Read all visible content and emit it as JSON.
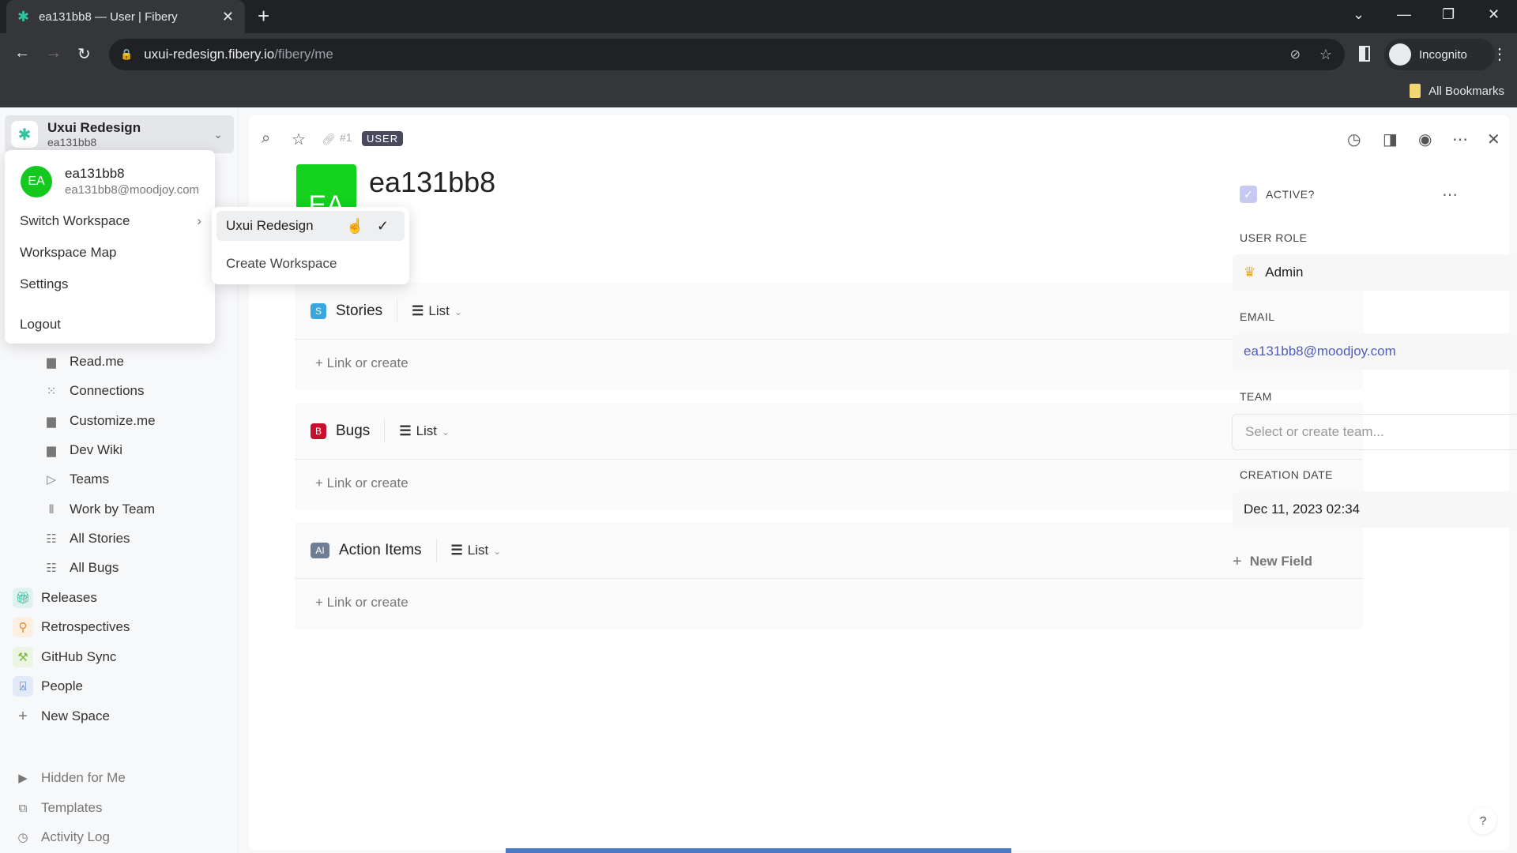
{
  "browser": {
    "tab_title": "ea131bb8 — User | Fibery",
    "url_host": "uxui-redesign.fibery.io",
    "url_path": "/fibery/me",
    "profile_label": "Incognito",
    "bookmarks_label": "All Bookmarks"
  },
  "workspace": {
    "name": "Uxui Redesign",
    "user": "ea131bb8"
  },
  "account_menu": {
    "avatar_initials": "EA",
    "user_name": "ea131bb8",
    "user_email": "ea131bb8@moodjoy.com",
    "items": [
      "Switch Workspace",
      "Workspace Map",
      "Settings",
      "Logout"
    ]
  },
  "switch_submenu": {
    "selected": "Uxui Redesign",
    "create": "Create Workspace"
  },
  "sidebar": {
    "items": [
      {
        "label": "Read.me",
        "icon": "document-icon"
      },
      {
        "label": "Connections",
        "icon": "connections-icon"
      },
      {
        "label": "Customize.me",
        "icon": "document-icon"
      },
      {
        "label": "Dev Wiki",
        "icon": "document-icon"
      },
      {
        "label": "Teams",
        "icon": "triangle-icon"
      },
      {
        "label": "Work by Team",
        "icon": "board-icon"
      },
      {
        "label": "All Stories",
        "icon": "grid-icon"
      },
      {
        "label": "All Bugs",
        "icon": "grid-icon"
      }
    ],
    "spaces": [
      {
        "label": "Releases",
        "icon": "gift-icon",
        "color": "#2bb596"
      },
      {
        "label": "Retrospectives",
        "icon": "retro-icon",
        "color": "#e58a2c"
      },
      {
        "label": "GitHub Sync",
        "icon": "screw-icon",
        "color": "#7dba45"
      },
      {
        "label": "People",
        "icon": "person-icon",
        "color": "#2e62c9"
      },
      {
        "label": "New Space",
        "icon": "plus-icon"
      }
    ],
    "footer": [
      {
        "label": "Hidden for Me",
        "icon": "caret-right-icon"
      },
      {
        "label": "Templates",
        "icon": "templates-icon"
      },
      {
        "label": "Activity Log",
        "icon": "clock-icon"
      }
    ]
  },
  "entity": {
    "id_ref": "#1",
    "type_badge": "USER",
    "avatar_initials": "EA",
    "avatar_color": "#14d21e",
    "title": "ea131bb8"
  },
  "sections": [
    {
      "tag": "S",
      "tag_color": "#3aa7dc",
      "name": "Stories",
      "view": "List",
      "link": "Link or create"
    },
    {
      "tag": "B",
      "tag_color": "#c8102e",
      "name": "Bugs",
      "view": "List",
      "link": "Link or create"
    },
    {
      "tag": "AI",
      "tag_color": "#6f7d94",
      "name": "Action Items",
      "view": "List",
      "link": "Link or create"
    }
  ],
  "fields": {
    "active_label": "ACTIVE?",
    "active_checked": true,
    "user_role_label": "USER ROLE",
    "user_role": "Admin",
    "email_label": "EMAIL",
    "email": "ea131bb8@moodjoy.com",
    "team_label": "TEAM",
    "team_placeholder": "Select or create team...",
    "creation_label": "CREATION DATE",
    "creation_date": "Dec 11, 2023 02:34",
    "new_field": "New Field"
  },
  "help_label": "?"
}
